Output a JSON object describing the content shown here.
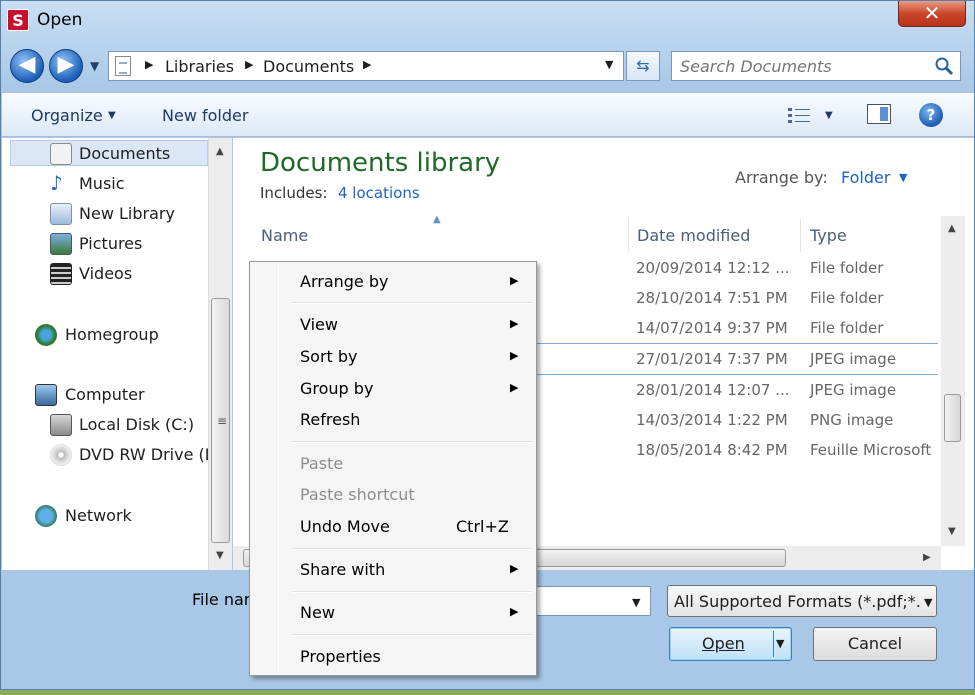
{
  "window": {
    "title": "Open",
    "app_icon_letter": "S",
    "close_glyph": "✕"
  },
  "nav": {
    "breadcrumbs": [
      "Libraries",
      "Documents"
    ],
    "search_placeholder": "Search Documents"
  },
  "toolbar": {
    "organize": "Organize",
    "new_folder": "New folder"
  },
  "sidebar": {
    "items": [
      {
        "label": "Documents",
        "icon": "documents-icon",
        "selected": true
      },
      {
        "label": "Music",
        "icon": "music-icon"
      },
      {
        "label": "New Library",
        "icon": "library-icon"
      },
      {
        "label": "Pictures",
        "icon": "pictures-icon"
      },
      {
        "label": "Videos",
        "icon": "videos-icon"
      },
      {
        "label": "Homegroup",
        "icon": "homegroup-icon"
      },
      {
        "label": "Computer",
        "icon": "computer-icon"
      },
      {
        "label": "Local Disk (C:)",
        "icon": "disk-icon"
      },
      {
        "label": "DVD RW Drive (D",
        "icon": "dvd-icon"
      },
      {
        "label": "Network",
        "icon": "network-icon"
      }
    ]
  },
  "library": {
    "title": "Documents library",
    "includes_label": "Includes:",
    "locations": "4 locations",
    "arrange_label": "Arrange by:",
    "arrange_value": "Folder"
  },
  "columns": {
    "name": "Name",
    "date": "Date modified",
    "type": "Type"
  },
  "rows": [
    {
      "date": "20/09/2014 12:12 ...",
      "type": "File folder"
    },
    {
      "date": "28/10/2014 7:51 PM",
      "type": "File folder"
    },
    {
      "date": "14/07/2014 9:37 PM",
      "type": "File folder"
    },
    {
      "date": "27/01/2014 7:37 PM",
      "type": "JPEG image"
    },
    {
      "date": "28/01/2014 12:07 ...",
      "type": "JPEG image"
    },
    {
      "date": "14/03/2014 1:22 PM",
      "type": "PNG image"
    },
    {
      "date": "18/05/2014 8:42 PM",
      "type": "Feuille Microsoft"
    }
  ],
  "bottom": {
    "filename_label": "File nar",
    "filename_value": "",
    "filetype": "All Supported Formats (*.pdf;*.x",
    "open": "Open",
    "cancel": "Cancel"
  },
  "context_menu": {
    "items": [
      {
        "label": "Arrange by",
        "submenu": true
      },
      {
        "label": "View",
        "submenu": true
      },
      {
        "label": "Sort by",
        "submenu": true
      },
      {
        "label": "Group by",
        "submenu": true
      },
      {
        "label": "Refresh"
      },
      {
        "label": "Paste",
        "disabled": true
      },
      {
        "label": "Paste shortcut",
        "disabled": true
      },
      {
        "label": "Undo Move",
        "shortcut": "Ctrl+Z"
      },
      {
        "label": "Share with",
        "submenu": true
      },
      {
        "label": "New",
        "submenu": true
      },
      {
        "label": "Properties"
      }
    ]
  },
  "colors": {
    "accent_blue": "#1f64c4",
    "library_title_green": "#1e6b27",
    "close_red": "#c9462a"
  }
}
